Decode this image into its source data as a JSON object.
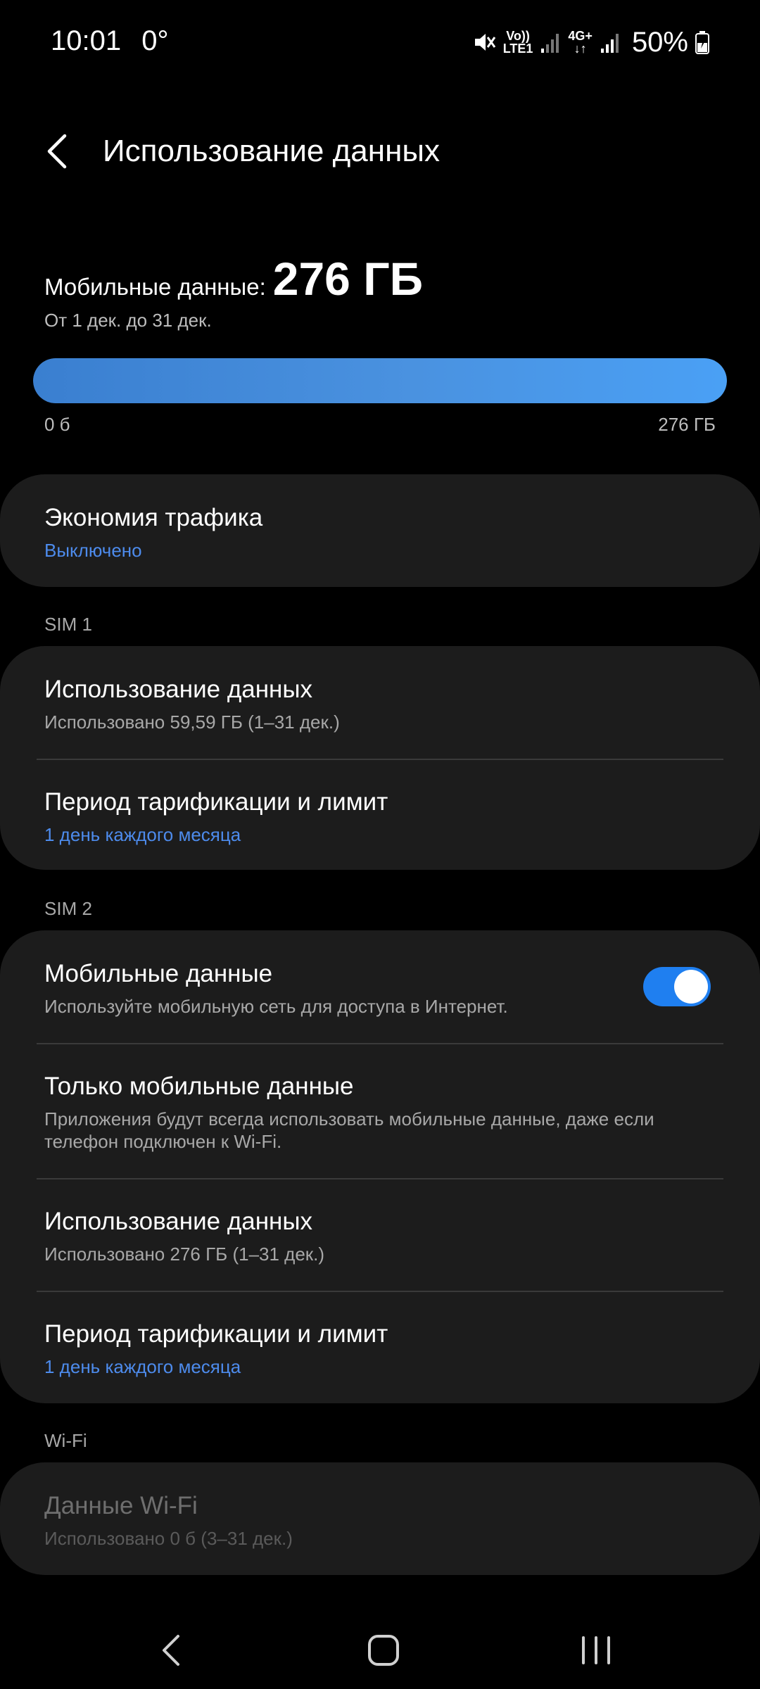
{
  "status_bar": {
    "time": "10:01",
    "temperature": "0°",
    "volte": "Vo))",
    "lte1": "LTE1",
    "net_type": "4G+",
    "battery": "50%",
    "icons": [
      "mute-icon",
      "signal-icon",
      "data-arrows-icon",
      "signal-icon",
      "battery-charging-icon"
    ]
  },
  "header": {
    "title": "Использование данных",
    "back_icon": "chevron-left-icon"
  },
  "summary": {
    "label": "Мобильные данные:",
    "value": "276 ГБ",
    "period": "От 1 дек. до 31 дек.",
    "bar_min": "0 б",
    "bar_max": "276 ГБ",
    "bar_fill_percent": 100,
    "bar_color": "#4a92e0"
  },
  "data_saver": {
    "title": "Экономия трафика",
    "status": "Выключено"
  },
  "sim1": {
    "label": "SIM 1",
    "usage": {
      "title": "Использование данных",
      "subtitle": "Использовано 59,59 ГБ (1–31 дек.)"
    },
    "billing": {
      "title": "Период тарификации и лимит",
      "subtitle": "1 день каждого месяца"
    }
  },
  "sim2": {
    "label": "SIM 2",
    "mobile_data": {
      "title": "Мобильные данные",
      "subtitle": "Используйте мобильную сеть для доступа в Интернет.",
      "enabled": true
    },
    "mobile_only": {
      "title": "Только мобильные данные",
      "subtitle": "Приложения будут всегда использовать мобильные данные, даже если телефон подключен к Wi-Fi."
    },
    "usage": {
      "title": "Использование данных",
      "subtitle": "Использовано 276 ГБ (1–31 дек.)"
    },
    "billing": {
      "title": "Период тарификации и лимит",
      "subtitle": "1 день каждого месяца"
    }
  },
  "wifi": {
    "label": "Wi-Fi",
    "data": {
      "title": "Данные Wi-Fi",
      "subtitle": "Использовано 0 б (3–31 дек.)"
    }
  },
  "nav_bar": {
    "buttons": [
      "back-nav-icon",
      "home-nav-icon",
      "recents-nav-icon"
    ]
  },
  "colors": {
    "accent_blue": "#4d8bec",
    "toggle_on": "#1f7ff0",
    "card_bg": "#1c1c1c",
    "background": "#000000"
  }
}
